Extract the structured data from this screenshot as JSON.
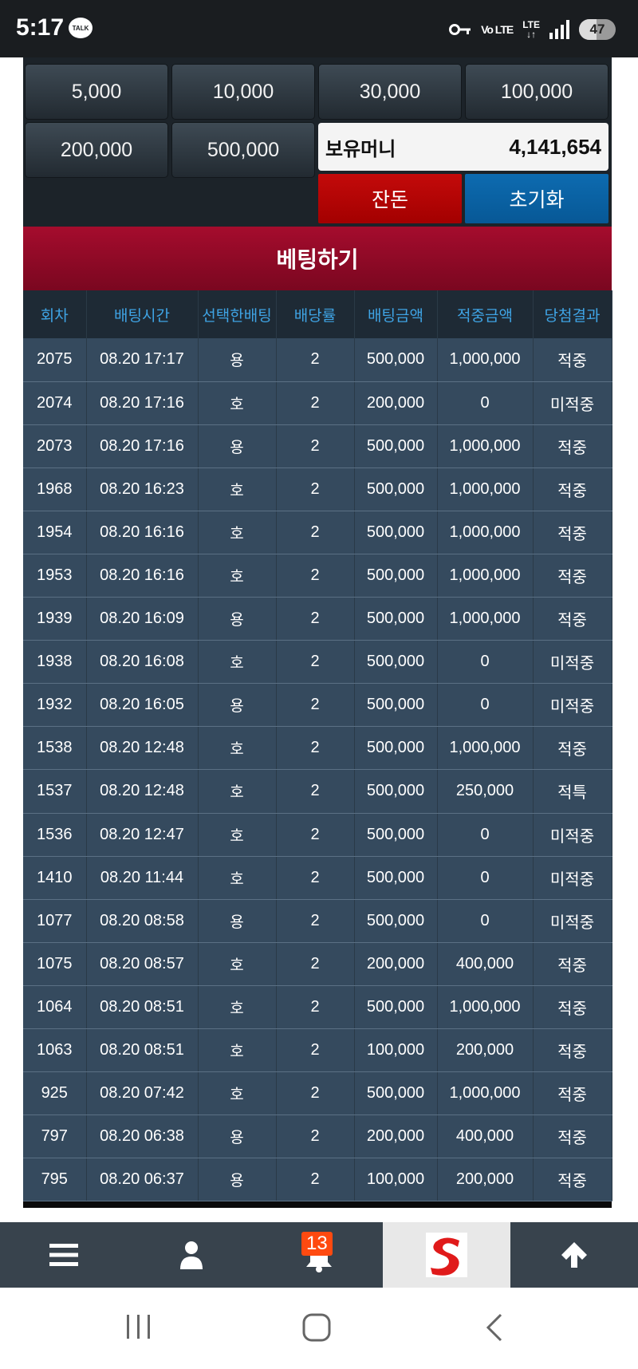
{
  "status_bar": {
    "time": "5:17",
    "talk_badge": "TALK",
    "volte": "Vo LTE",
    "lte_top": "LTE",
    "battery": "47",
    "battery_level": 0.47
  },
  "chips": [
    "5,000",
    "10,000",
    "30,000",
    "100,000",
    "200,000",
    "500,000"
  ],
  "balance": {
    "label": "보유머니",
    "value": "4,141,654"
  },
  "buttons": {
    "rest": "잔돈",
    "reset": "초기화",
    "bet": "베팅하기"
  },
  "table": {
    "headers": [
      "회차",
      "배팅시간",
      "선택한배팅",
      "배당률",
      "배팅금액",
      "적중금액",
      "당첨결과"
    ],
    "rows": [
      {
        "round": "2075",
        "time": "08.20 17:17",
        "pick": "용",
        "odds": "2",
        "bet": "500,000",
        "win": "1,000,000",
        "result": "적중",
        "status": "win"
      },
      {
        "round": "2074",
        "time": "08.20 17:16",
        "pick": "호",
        "odds": "2",
        "bet": "200,000",
        "win": "0",
        "result": "미적중",
        "status": "lose"
      },
      {
        "round": "2073",
        "time": "08.20 17:16",
        "pick": "용",
        "odds": "2",
        "bet": "500,000",
        "win": "1,000,000",
        "result": "적중",
        "status": "win"
      },
      {
        "round": "1968",
        "time": "08.20 16:23",
        "pick": "호",
        "odds": "2",
        "bet": "500,000",
        "win": "1,000,000",
        "result": "적중",
        "status": "win"
      },
      {
        "round": "1954",
        "time": "08.20 16:16",
        "pick": "호",
        "odds": "2",
        "bet": "500,000",
        "win": "1,000,000",
        "result": "적중",
        "status": "win"
      },
      {
        "round": "1953",
        "time": "08.20 16:16",
        "pick": "호",
        "odds": "2",
        "bet": "500,000",
        "win": "1,000,000",
        "result": "적중",
        "status": "win"
      },
      {
        "round": "1939",
        "time": "08.20 16:09",
        "pick": "용",
        "odds": "2",
        "bet": "500,000",
        "win": "1,000,000",
        "result": "적중",
        "status": "win"
      },
      {
        "round": "1938",
        "time": "08.20 16:08",
        "pick": "호",
        "odds": "2",
        "bet": "500,000",
        "win": "0",
        "result": "미적중",
        "status": "lose"
      },
      {
        "round": "1932",
        "time": "08.20 16:05",
        "pick": "용",
        "odds": "2",
        "bet": "500,000",
        "win": "0",
        "result": "미적중",
        "status": "lose"
      },
      {
        "round": "1538",
        "time": "08.20 12:48",
        "pick": "호",
        "odds": "2",
        "bet": "500,000",
        "win": "1,000,000",
        "result": "적중",
        "status": "win"
      },
      {
        "round": "1537",
        "time": "08.20 12:48",
        "pick": "호",
        "odds": "2",
        "bet": "500,000",
        "win": "250,000",
        "result": "적특",
        "status": "part"
      },
      {
        "round": "1536",
        "time": "08.20 12:47",
        "pick": "호",
        "odds": "2",
        "bet": "500,000",
        "win": "0",
        "result": "미적중",
        "status": "lose"
      },
      {
        "round": "1410",
        "time": "08.20 11:44",
        "pick": "호",
        "odds": "2",
        "bet": "500,000",
        "win": "0",
        "result": "미적중",
        "status": "lose"
      },
      {
        "round": "1077",
        "time": "08.20 08:58",
        "pick": "용",
        "odds": "2",
        "bet": "500,000",
        "win": "0",
        "result": "미적중",
        "status": "lose"
      },
      {
        "round": "1075",
        "time": "08.20 08:57",
        "pick": "호",
        "odds": "2",
        "bet": "200,000",
        "win": "400,000",
        "result": "적중",
        "status": "win"
      },
      {
        "round": "1064",
        "time": "08.20 08:51",
        "pick": "호",
        "odds": "2",
        "bet": "500,000",
        "win": "1,000,000",
        "result": "적중",
        "status": "win"
      },
      {
        "round": "1063",
        "time": "08.20 08:51",
        "pick": "호",
        "odds": "2",
        "bet": "100,000",
        "win": "200,000",
        "result": "적중",
        "status": "win"
      },
      {
        "round": "925",
        "time": "08.20 07:42",
        "pick": "호",
        "odds": "2",
        "bet": "500,000",
        "win": "1,000,000",
        "result": "적중",
        "status": "win"
      },
      {
        "round": "797",
        "time": "08.20 06:38",
        "pick": "용",
        "odds": "2",
        "bet": "200,000",
        "win": "400,000",
        "result": "적중",
        "status": "win"
      },
      {
        "round": "795",
        "time": "08.20 06:37",
        "pick": "용",
        "odds": "2",
        "bet": "100,000",
        "win": "200,000",
        "result": "적중",
        "status": "win"
      }
    ]
  },
  "bottom_nav": {
    "notification_count": "13",
    "items": [
      "menu-icon",
      "user-icon",
      "bell-icon",
      "site-logo",
      "arrow-up-icon"
    ]
  },
  "colors": {
    "win": "#0c7a1c",
    "lose": "#d0242d",
    "partial": "#f0a020",
    "bet_button": "#a50c2d",
    "reset_button": "#0d6bb0",
    "rest_button": "#c30a0a"
  }
}
